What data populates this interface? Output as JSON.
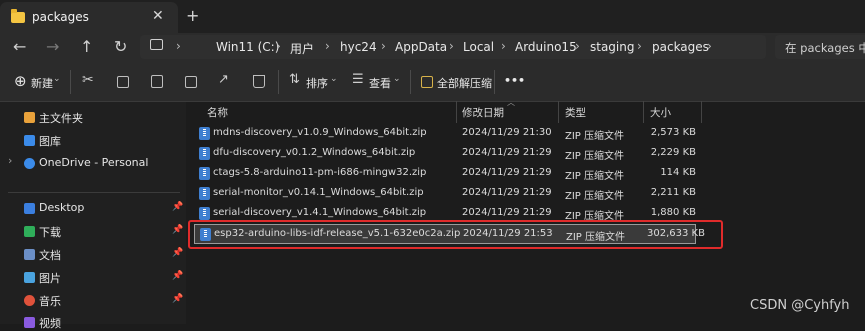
{
  "tab": {
    "title": "packages"
  },
  "address": {
    "crumbs": [
      "Win11 (C:)",
      "用户",
      "hyc24",
      "AppData",
      "Local",
      "Arduino15",
      "staging",
      "packages"
    ]
  },
  "search": {
    "placeholder": "在 packages 中搜索"
  },
  "toolbar": {
    "new_label": "新建",
    "sort_label": "排序",
    "view_label": "查看",
    "extract_label": "全部解压缩",
    "more_label": "•••"
  },
  "sidebar": {
    "items": [
      {
        "label": "主文件夹",
        "color": "#e9a23b"
      },
      {
        "label": "图库",
        "color": "#3b8be9"
      },
      {
        "label": "OneDrive - Personal",
        "color": "#3b8be9"
      },
      {
        "label": "Desktop",
        "color": "#3b7fe0"
      },
      {
        "label": "下载",
        "color": "#2fae5a"
      },
      {
        "label": "文档",
        "color": "#6b8fc7"
      },
      {
        "label": "图片",
        "color": "#4aa3df"
      },
      {
        "label": "音乐",
        "color": "#e0523b"
      },
      {
        "label": "视频",
        "color": "#8a5be0"
      }
    ]
  },
  "columns": {
    "name": "名称",
    "date": "修改日期",
    "type": "类型",
    "size": "大小"
  },
  "files": [
    {
      "name": "mdns-discovery_v1.0.9_Windows_64bit.zip",
      "date": "2024/11/29 21:30",
      "type": "ZIP 压缩文件",
      "size": "2,573 KB"
    },
    {
      "name": "dfu-discovery_v0.1.2_Windows_64bit.zip",
      "date": "2024/11/29 21:29",
      "type": "ZIP 压缩文件",
      "size": "2,229 KB"
    },
    {
      "name": "ctags-5.8-arduino11-pm-i686-mingw32.zip",
      "date": "2024/11/29 21:29",
      "type": "ZIP 压缩文件",
      "size": "114 KB"
    },
    {
      "name": "serial-monitor_v0.14.1_Windows_64bit.zip",
      "date": "2024/11/29 21:29",
      "type": "ZIP 压缩文件",
      "size": "2,211 KB"
    },
    {
      "name": "serial-discovery_v1.4.1_Windows_64bit.zip",
      "date": "2024/11/29 21:29",
      "type": "ZIP 压缩文件",
      "size": "1,880 KB"
    },
    {
      "name": "esp32-arduino-libs-idf-release_v5.1-632e0c2a.zip",
      "date": "2024/11/29 21:53",
      "type": "ZIP 压缩文件",
      "size": "302,633 KB"
    }
  ],
  "watermark": "CSDN @Cyhfyh"
}
